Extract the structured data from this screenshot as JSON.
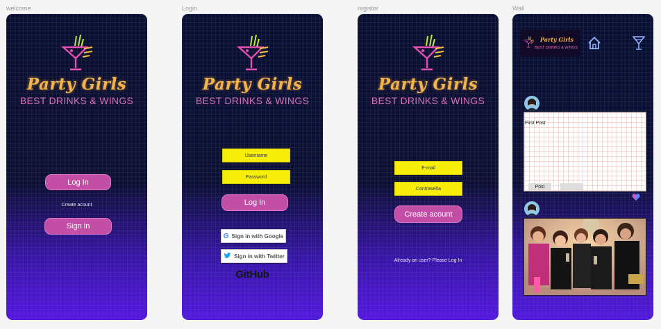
{
  "frames": {
    "welcome": {
      "label": "welcome",
      "brand": "Party Girls",
      "tagline": "BEST DRINKS & WINGS",
      "login_button": "Log In",
      "create_account_link": "Create acount",
      "signin_button": "Sign in"
    },
    "login": {
      "label": "Login",
      "brand": "Party Girls",
      "tagline": "BEST DRINKS & WINGS",
      "username_placeholder": "Username",
      "password_placeholder": "Password",
      "login_button": "Log In",
      "google_button": "Sign in with Google",
      "twitter_button": "Sign in with Twitter",
      "github_text": "GitHub"
    },
    "register": {
      "label": "register",
      "brand": "Party Girls",
      "tagline": "BEST DRINKS & WINGS",
      "email_placeholder": "E-mail",
      "password_placeholder": "Contraseña",
      "create_button": "Create acount",
      "already_user_link": "Already an user? Please Log In"
    },
    "wall": {
      "label": "Wall",
      "mini_brand": "Party Girls",
      "mini_tagline": "BEST DRINKS & WINGS",
      "post_text": "First Post",
      "post_button": "Post"
    }
  },
  "icons": {
    "home": "home-icon",
    "cocktail": "cocktail-icon",
    "heart": "heart-icon",
    "google": "google-g-icon",
    "twitter": "twitter-bird-icon"
  },
  "colors": {
    "accent_pink": "#c24ea6",
    "brand_gold": "#f4b44a",
    "tagline_pink": "#d86fb8",
    "input_yellow": "#f7ef09",
    "gradient_bottom": "#5618e0",
    "gradient_top": "#0c1030"
  }
}
